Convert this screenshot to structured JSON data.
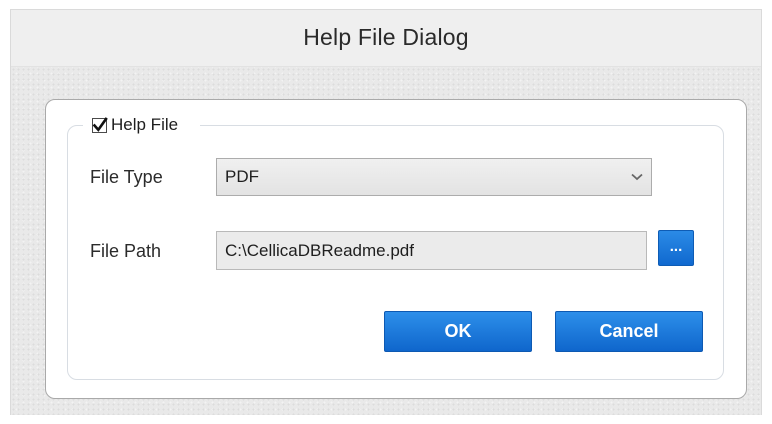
{
  "window": {
    "title": "Help File Dialog"
  },
  "group": {
    "label": "Help File",
    "checked": true
  },
  "file_type": {
    "label": "File Type",
    "value": "PDF",
    "icon": "chevron-down-icon"
  },
  "file_path": {
    "label": "File Path",
    "value": "C:\\CellicaDBReadme.pdf",
    "browse_label": "..."
  },
  "buttons": {
    "ok_label": "OK",
    "cancel_label": "Cancel"
  },
  "colors": {
    "button_blue": "#1a78db",
    "panel_border": "#a9a9a9",
    "background": "#ededed"
  }
}
